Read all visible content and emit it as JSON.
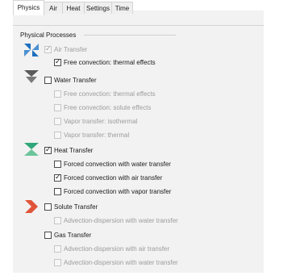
{
  "tabs": [
    {
      "label": "Physics",
      "active": true
    },
    {
      "label": "Air",
      "active": false
    },
    {
      "label": "Heat",
      "active": false
    },
    {
      "label": "Settings",
      "active": false
    },
    {
      "label": "Time",
      "active": false
    }
  ],
  "section_title": "Physical Processes",
  "colors": {
    "air": "#1e6fbf",
    "water": "#5a5a5a",
    "heat": "#2fa77a",
    "solute": "#e0553a"
  },
  "processes": {
    "air_transfer": {
      "label": "Air Transfer",
      "checked": true,
      "enabled": false,
      "icon": "air-transfer-icon"
    },
    "air_free_convection": {
      "label": "Free convection: thermal effects",
      "checked": true,
      "enabled": true
    },
    "water_transfer": {
      "label": "Water Transfer",
      "checked": false,
      "enabled": true,
      "icon": "water-transfer-icon"
    },
    "water_free_thermal": {
      "label": "Free convection: thermal effects",
      "checked": false,
      "enabled": false
    },
    "water_free_solute": {
      "label": "Free convection: solute effects",
      "checked": false,
      "enabled": false
    },
    "vapor_isothermal": {
      "label": "Vapor transfer: isothermal",
      "checked": false,
      "enabled": false
    },
    "vapor_thermal": {
      "label": "Vapor transfer: thermal",
      "checked": false,
      "enabled": false
    },
    "heat_transfer": {
      "label": "Heat Transfer",
      "checked": true,
      "enabled": true,
      "icon": "heat-transfer-icon"
    },
    "forced_water": {
      "label": "Forced convection with water transfer",
      "checked": false,
      "enabled": true
    },
    "forced_air": {
      "label": "Forced convection with air transfer",
      "checked": true,
      "enabled": true
    },
    "forced_vapor": {
      "label": "Forced convection with vapor transfer",
      "checked": false,
      "enabled": true
    },
    "solute_transfer": {
      "label": "Solute Transfer",
      "checked": false,
      "enabled": true,
      "icon": "solute-transfer-icon"
    },
    "solute_adv_water": {
      "label": "Advection-dispersion with water transfer",
      "checked": false,
      "enabled": false
    },
    "gas_transfer": {
      "label": "Gas Transfer",
      "checked": false,
      "enabled": true
    },
    "gas_adv_air": {
      "label": "Advection-dispersion with air transfer",
      "checked": false,
      "enabled": false
    },
    "gas_adv_water": {
      "label": "Advection-dispersion with water transfer",
      "checked": false,
      "enabled": false
    }
  }
}
